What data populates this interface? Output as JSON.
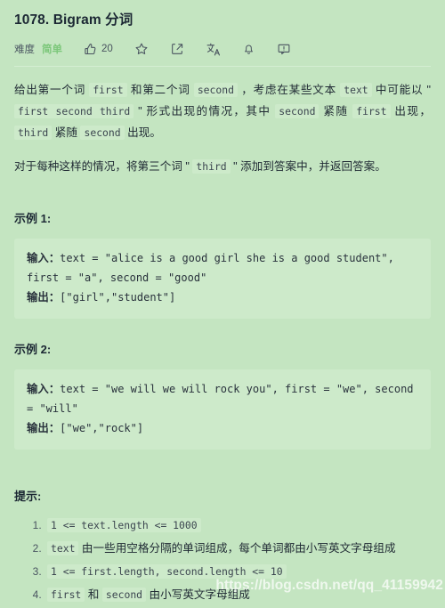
{
  "problem": {
    "title": "1078. Bigram 分词",
    "difficulty_label": "难度",
    "difficulty_value": "简单",
    "like_count": "20"
  },
  "toolbar": {
    "like": "thumbs-up-icon",
    "favorite": "star-icon",
    "share": "share-icon",
    "translate": "translate-icon",
    "notify": "bell-icon",
    "feedback": "feedback-icon"
  },
  "description": {
    "p1": {
      "t1": "给出第一个词 ",
      "c1": "first",
      "t2": " 和第二个词 ",
      "c2": "second",
      "t3": " ，考虑在某些文本 ",
      "c3": "text",
      "t4": " 中可能以 \" ",
      "c4": "first second third",
      "t5": " \" 形式出现的情况，其中 ",
      "c5": "second",
      "t6": " 紧随 ",
      "c6": "first",
      "t7": " 出现， ",
      "c7": "third",
      "t8": " 紧随 ",
      "c8": "second",
      "t9": " 出现。"
    },
    "p2": {
      "t1": "对于每种这样的情况，将第三个词 \" ",
      "c1": "third",
      "t2": " \" 添加到答案中，并返回答案。"
    }
  },
  "examples": [
    {
      "heading": "示例 1:",
      "input_label": "输入：",
      "input_value": "text = \"alice is a good girl she is a good student\", first = \"a\", second = \"good\"",
      "output_label": "输出：",
      "output_value": "[\"girl\",\"student\"]"
    },
    {
      "heading": "示例 2:",
      "input_label": "输入：",
      "input_value": "text = \"we will we will rock you\", first = \"we\", second = \"will\"",
      "output_label": "输出：",
      "output_value": "[\"we\",\"rock\"]"
    }
  ],
  "constraints": {
    "heading": "提示:",
    "items": [
      {
        "c1": "1 <= text.length <= 1000",
        "t1": ""
      },
      {
        "c1": "text",
        "t1": " 由一些用空格分隔的单词组成，每个单词都由小写英文字母组成"
      },
      {
        "c1": "1 <= first.length, second.length <= 10",
        "t1": ""
      },
      {
        "c1": "first",
        "t1": " 和 ",
        "c2": "second",
        "t2": " 由小写英文字母组成"
      }
    ]
  },
  "watermark": "https://blog.csdn.net/qq_41159942",
  "colors": {
    "page_bg": "#c4e5c1",
    "code_bg": "#cdeaca",
    "easy_green": "#7cc77a",
    "text": "#1f2933"
  }
}
